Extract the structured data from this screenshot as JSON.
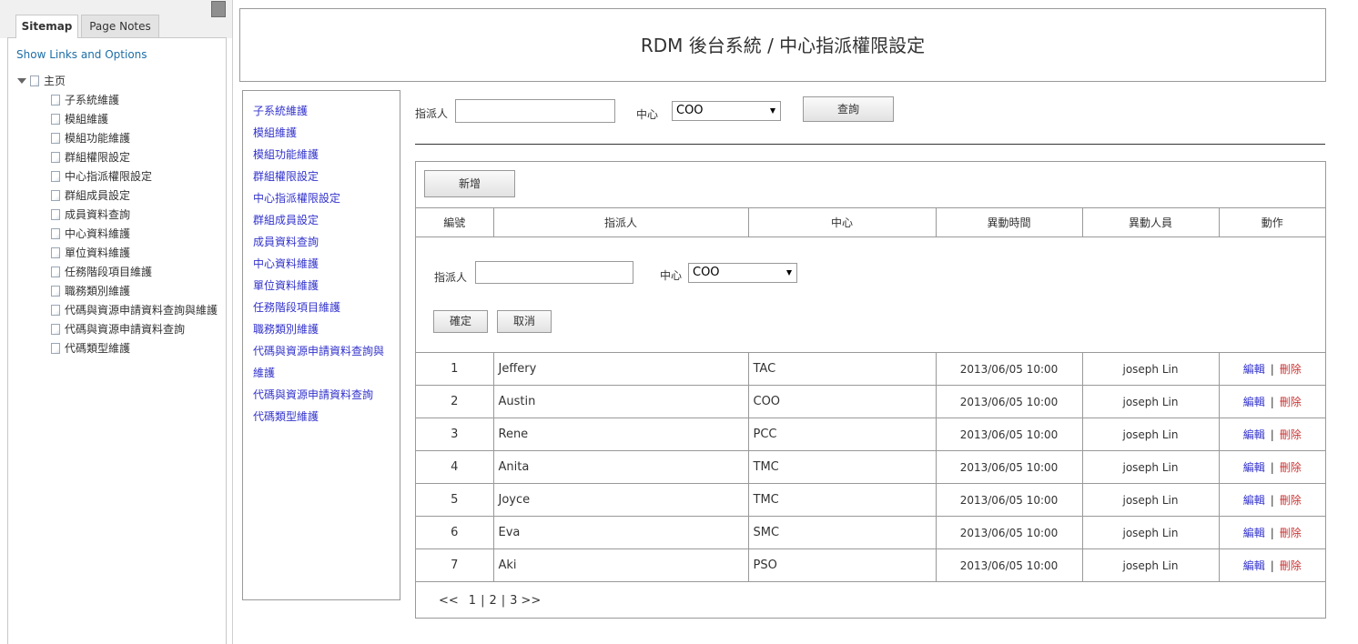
{
  "sitemap": {
    "tabs": {
      "sitemap": "Sitemap",
      "page_notes": "Page Notes"
    },
    "show_links": "Show Links and Options",
    "root": "主页",
    "children": [
      "子系統維護",
      "模組維護",
      "模組功能維護",
      "群組權限設定",
      "中心指派權限設定",
      "群組成員設定",
      "成員資料查詢",
      "中心資料維護",
      "單位資料維護",
      "任務階段項目維護",
      "職務類別維護",
      "代碼與資源申請資料查詢與維護",
      "代碼與資源申請資料查詢",
      "代碼類型維護"
    ]
  },
  "header": {
    "title": "RDM 後台系統 / 中心指派權限設定"
  },
  "nav": {
    "items": [
      "子系統維護",
      "模組維護",
      "模組功能維護",
      "群組權限設定",
      "中心指派權限設定",
      "群組成員設定",
      "成員資料查詢",
      "中心資料維護",
      "單位資料維護",
      "任務階段項目維護",
      "職務類別維護",
      "代碼與資源申請資料查詢與維護",
      "代碼與資源申請資料查詢",
      "代碼類型維護"
    ]
  },
  "search": {
    "assignee_label": "指派人",
    "assignee_value": "",
    "center_label": "中心",
    "center_value": "COO",
    "query_button": "查詢"
  },
  "panel": {
    "add_button": "新增",
    "columns": [
      "編號",
      "指派人",
      "中心",
      "異動時間",
      "異動人員",
      "動作"
    ],
    "form": {
      "assignee_label": "指派人",
      "assignee_value": "",
      "center_label": "中心",
      "center_value": "COO",
      "confirm_button": "確定",
      "cancel_button": "取消"
    },
    "rows": [
      {
        "id": "1",
        "assignee": "Jeffery",
        "center": "TAC",
        "time": "2013/06/05  10:00",
        "modifier": "joseph Lin"
      },
      {
        "id": "2",
        "assignee": "Austin",
        "center": "COO",
        "time": "2013/06/05  10:00",
        "modifier": "joseph Lin"
      },
      {
        "id": "3",
        "assignee": "Rene",
        "center": "PCC",
        "time": "2013/06/05  10:00",
        "modifier": "joseph Lin"
      },
      {
        "id": "4",
        "assignee": "Anita",
        "center": "TMC",
        "time": "2013/06/05  10:00",
        "modifier": "joseph Lin"
      },
      {
        "id": "5",
        "assignee": "Joyce",
        "center": "TMC",
        "time": "2013/06/05  10:00",
        "modifier": "joseph Lin"
      },
      {
        "id": "6",
        "assignee": "Eva",
        "center": "SMC",
        "time": "2013/06/05  10:00",
        "modifier": "joseph Lin"
      },
      {
        "id": "7",
        "assignee": "Aki",
        "center": "PSO",
        "time": "2013/06/05  10:00",
        "modifier": "joseph Lin"
      }
    ],
    "actions": {
      "edit": "編輯",
      "sep": "|",
      "delete": "刪除"
    },
    "pager": {
      "prev": "<<",
      "pages": [
        "1",
        "2",
        "3"
      ],
      "sep": "|",
      "next": ">>"
    }
  }
}
